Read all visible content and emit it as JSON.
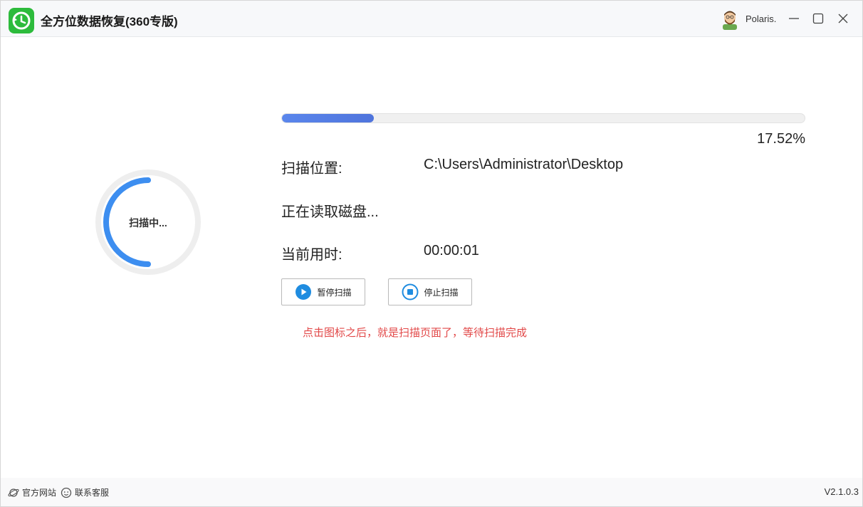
{
  "app": {
    "title": "全方位数据恢复(360专版)",
    "brand_color": "#2dbb3c"
  },
  "user": {
    "name": "Polaris."
  },
  "window_controls": [
    "minimize-icon",
    "maximize-icon",
    "close-icon"
  ],
  "scan": {
    "status_label": "扫描中...",
    "progress": 0.1752,
    "progress_text": "17.52%",
    "location_label": "扫描位置:",
    "location_value": "C:\\Users\\Administrator\\Desktop",
    "reading_text": "正在读取磁盘...",
    "elapsed_label": "当前用时:",
    "elapsed_value": "00:00:01",
    "pause_button": "暂停扫描",
    "stop_button": "停止扫描",
    "accent_color": "#3d8ef0",
    "progress_color": "#5a86ec"
  },
  "hint": {
    "text": "点击图标之后，就是扫描页面了，等待扫描完成",
    "color": "#e24848"
  },
  "footer": {
    "website_label": "官方网站",
    "support_label": "联系客服",
    "version": "V2.1.0.3"
  }
}
